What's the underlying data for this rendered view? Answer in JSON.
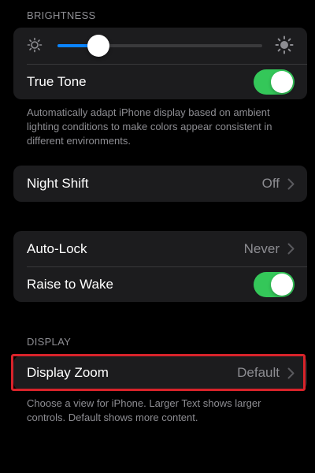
{
  "brightness": {
    "header": "BRIGHTNESS",
    "level": 0.2,
    "true_tone_label": "True Tone",
    "true_tone_on": true,
    "footer": "Automatically adapt iPhone display based on ambient lighting conditions to make colors appear consistent in different environments."
  },
  "night_shift": {
    "label": "Night Shift",
    "value": "Off"
  },
  "lock": {
    "auto_lock_label": "Auto-Lock",
    "auto_lock_value": "Never",
    "raise_to_wake_label": "Raise to Wake",
    "raise_to_wake_on": true
  },
  "display": {
    "header": "DISPLAY",
    "zoom_label": "Display Zoom",
    "zoom_value": "Default",
    "footer": "Choose a view for iPhone. Larger Text shows larger controls. Default shows more content."
  },
  "colors": {
    "background": "#000000",
    "group": "#1c1c1e",
    "accent": "#0a84ff",
    "toggle_on": "#34c759",
    "highlight": "#d8232a",
    "secondary_text": "#8d8d92"
  },
  "icons": {
    "brightness_low": "sun-small-icon",
    "brightness_high": "sun-large-icon",
    "chevron": "chevron-right-icon"
  }
}
